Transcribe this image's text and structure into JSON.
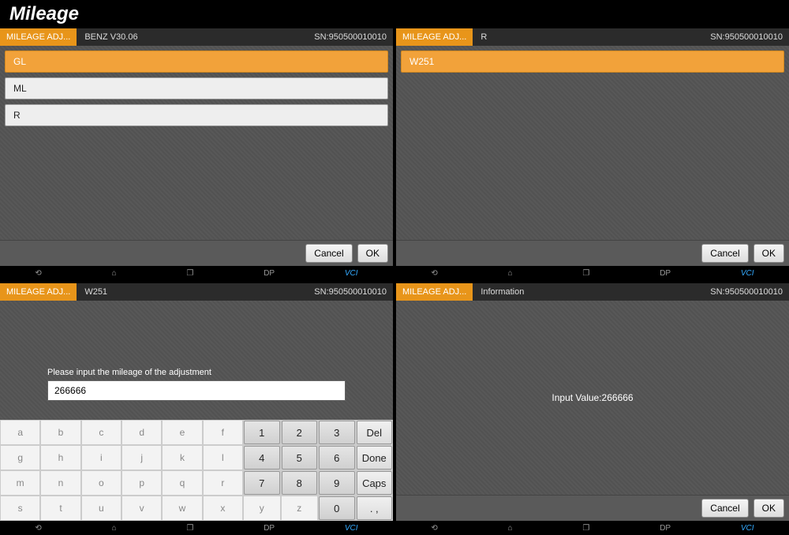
{
  "page_title": "Mileage",
  "screens": {
    "s1": {
      "tab": "MILEAGE ADJ...",
      "crumb": "BENZ  V30.06",
      "sn": "SN:950500010010",
      "rows": [
        "GL",
        "ML",
        "R"
      ],
      "selected": 0,
      "cancel": "Cancel",
      "ok": "OK"
    },
    "s2": {
      "tab": "MILEAGE ADJ...",
      "crumb": "R",
      "sn": "SN:950500010010",
      "rows": [
        "W251"
      ],
      "selected": 0,
      "cancel": "Cancel",
      "ok": "OK"
    },
    "s3": {
      "tab": "MILEAGE ADJ...",
      "crumb": "W251",
      "sn": "SN:950500010010",
      "prompt": "Please input the mileage of the adjustment",
      "value": "266666",
      "alpha": [
        "a",
        "b",
        "c",
        "d",
        "e",
        "f",
        "g",
        "h",
        "i",
        "j",
        "k",
        "l",
        "m",
        "n",
        "o",
        "p",
        "q",
        "r",
        "s",
        "t",
        "u",
        "v",
        "w",
        "x",
        "y",
        "z"
      ],
      "nums": [
        "1",
        "2",
        "3",
        "4",
        "5",
        "6",
        "7",
        "8",
        "9",
        "0"
      ],
      "del": "Del",
      "done": "Done",
      "caps": "Caps",
      "dots": ". ,"
    },
    "s4": {
      "tab": "MILEAGE ADJ...",
      "crumb": "Information",
      "sn": "SN:950500010010",
      "message": "Input Value:266666",
      "cancel": "Cancel",
      "ok": "OK"
    }
  },
  "nav": {
    "dp": "DP",
    "vci": "VCI"
  }
}
